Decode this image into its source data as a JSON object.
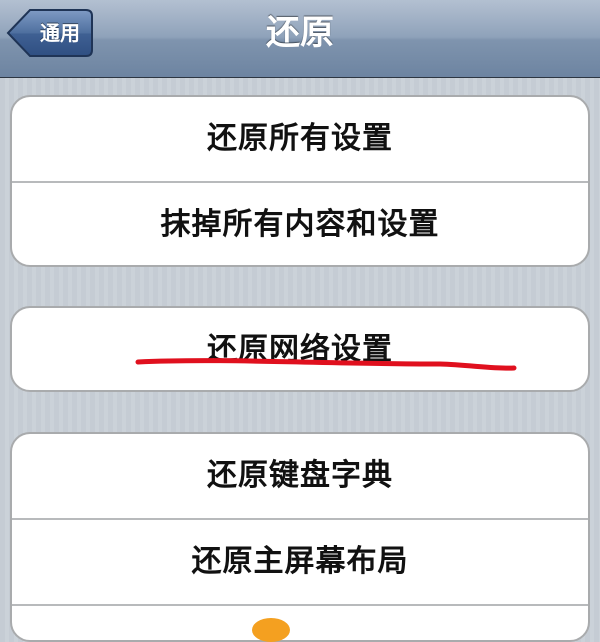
{
  "navbar": {
    "back_label": "通用",
    "title": "还原"
  },
  "groups": [
    {
      "items": [
        "还原所有设置",
        "抹掉所有内容和设置"
      ]
    },
    {
      "items": [
        "还原网络设置"
      ]
    },
    {
      "items": [
        "还原键盘字典",
        "还原主屏幕布局"
      ]
    }
  ],
  "colors": {
    "background": "#c5ccd4",
    "navbar_top": "#b3c0d1",
    "navbar_bottom": "#6d84a1",
    "back_button": "#3f5f8f",
    "annotation_stroke": "#e0101e"
  }
}
